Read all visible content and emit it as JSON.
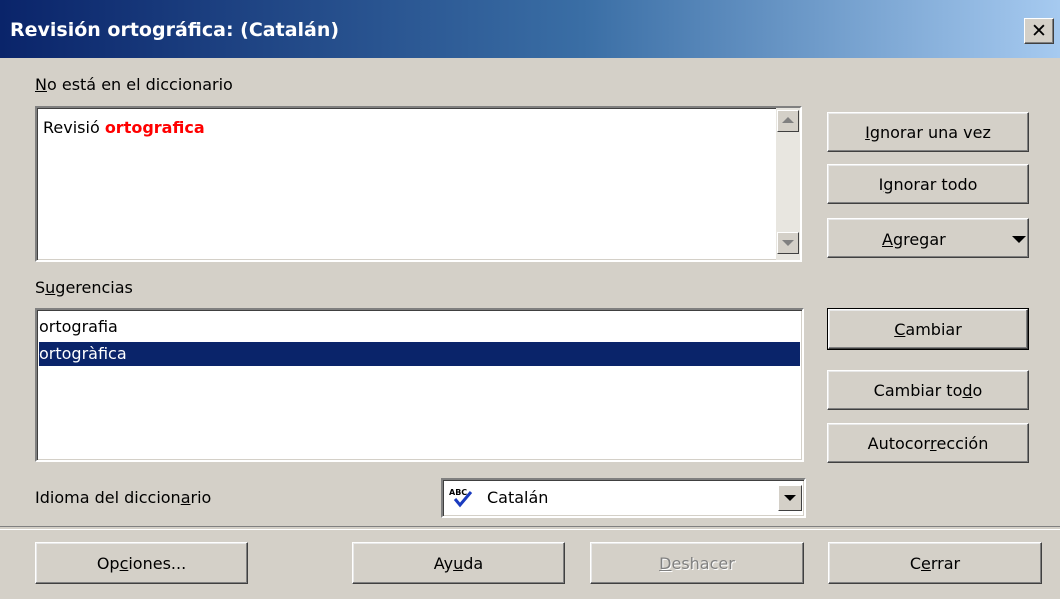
{
  "window": {
    "title": "Revisión ortográfica: (Catalán)",
    "close_glyph": "✕"
  },
  "not_in_dictionary": {
    "label_u": "N",
    "label_rest": "o está en el diccionario",
    "text_normal": "Revisió ",
    "text_error": "ortografica",
    "error_color": "#ff0000"
  },
  "suggestions": {
    "label_pre": "S",
    "label_u": "u",
    "label_rest": "gerencias",
    "items": [
      "ortografia",
      "ortogràfica"
    ],
    "selected_index": 1
  },
  "language": {
    "label_pre": "Idioma del diccion",
    "label_u": "a",
    "label_rest": "rio",
    "value": "Catalán",
    "icon": "spellcheck-abc-icon"
  },
  "buttons": {
    "ignore_once": {
      "pre": "",
      "u": "I",
      "post": "gnorar una vez"
    },
    "ignore_all": {
      "pre": "I",
      "u": "g",
      "post": "norar todo"
    },
    "add": {
      "pre": "",
      "u": "A",
      "post": "gregar"
    },
    "change": {
      "pre": "",
      "u": "C",
      "post": "ambiar"
    },
    "change_all": {
      "pre": "Cambiar to",
      "u": "d",
      "post": "o"
    },
    "autocorrect": {
      "pre": "Autocor",
      "u": "r",
      "post": "ección"
    },
    "options": {
      "pre": "Op",
      "u": "c",
      "post": "iones..."
    },
    "help": {
      "pre": "Ay",
      "u": "u",
      "post": "da"
    },
    "undo": {
      "pre": "",
      "u": "D",
      "post": "eshacer"
    },
    "close": {
      "pre": "C",
      "u": "e",
      "post": "rrar"
    }
  },
  "colors": {
    "selection": "#0a246a",
    "titlebar_start": "#0a246a",
    "face": "#d4d0c8"
  }
}
